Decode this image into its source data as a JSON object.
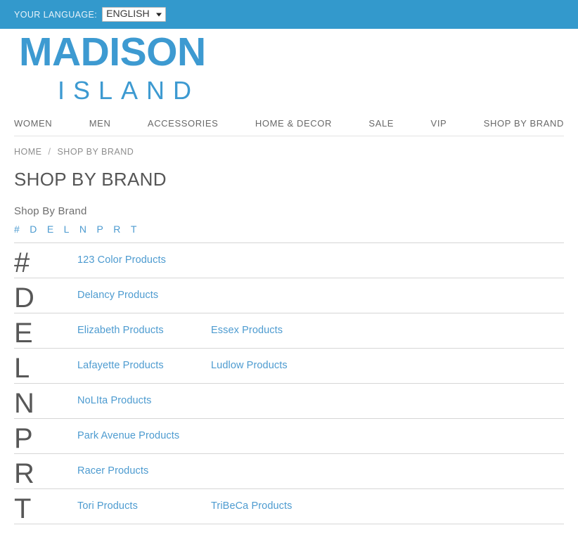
{
  "topbar": {
    "language_label": "YOUR LANGUAGE:",
    "language_value": "ENGLISH",
    "language_options": [
      "ENGLISH"
    ],
    "background_color": "#3399cc"
  },
  "logo": {
    "line1": "MADISON",
    "line2": "ISLAND",
    "color": "#3d9ad1"
  },
  "nav": {
    "items": [
      {
        "label": "WOMEN"
      },
      {
        "label": "MEN"
      },
      {
        "label": "ACCESSORIES"
      },
      {
        "label": "HOME & DECOR"
      },
      {
        "label": "SALE"
      },
      {
        "label": "VIP"
      },
      {
        "label": "SHOP BY BRAND"
      }
    ]
  },
  "breadcrumb": {
    "home": "HOME",
    "divider": "/",
    "current": "SHOP BY BRAND"
  },
  "page": {
    "title": "SHOP BY BRAND",
    "section_subtitle": "Shop By Brand"
  },
  "alphabet": {
    "letters": [
      "#",
      "D",
      "E",
      "L",
      "N",
      "P",
      "R",
      "T"
    ],
    "link_color": "#4d9bd0"
  },
  "brands": {
    "rows": [
      {
        "letter": "#",
        "links": [
          "123 Color Products"
        ]
      },
      {
        "letter": "D",
        "links": [
          "Delancy Products"
        ]
      },
      {
        "letter": "E",
        "links": [
          "Elizabeth Products",
          "Essex Products"
        ]
      },
      {
        "letter": "L",
        "links": [
          "Lafayette Products",
          "Ludlow Products"
        ]
      },
      {
        "letter": "N",
        "links": [
          "NoLIta Products"
        ]
      },
      {
        "letter": "P",
        "links": [
          "Park Avenue Products"
        ]
      },
      {
        "letter": "R",
        "links": [
          "Racer Products"
        ]
      },
      {
        "letter": "T",
        "links": [
          "Tori Products",
          "TriBeCa Products"
        ]
      }
    ]
  }
}
